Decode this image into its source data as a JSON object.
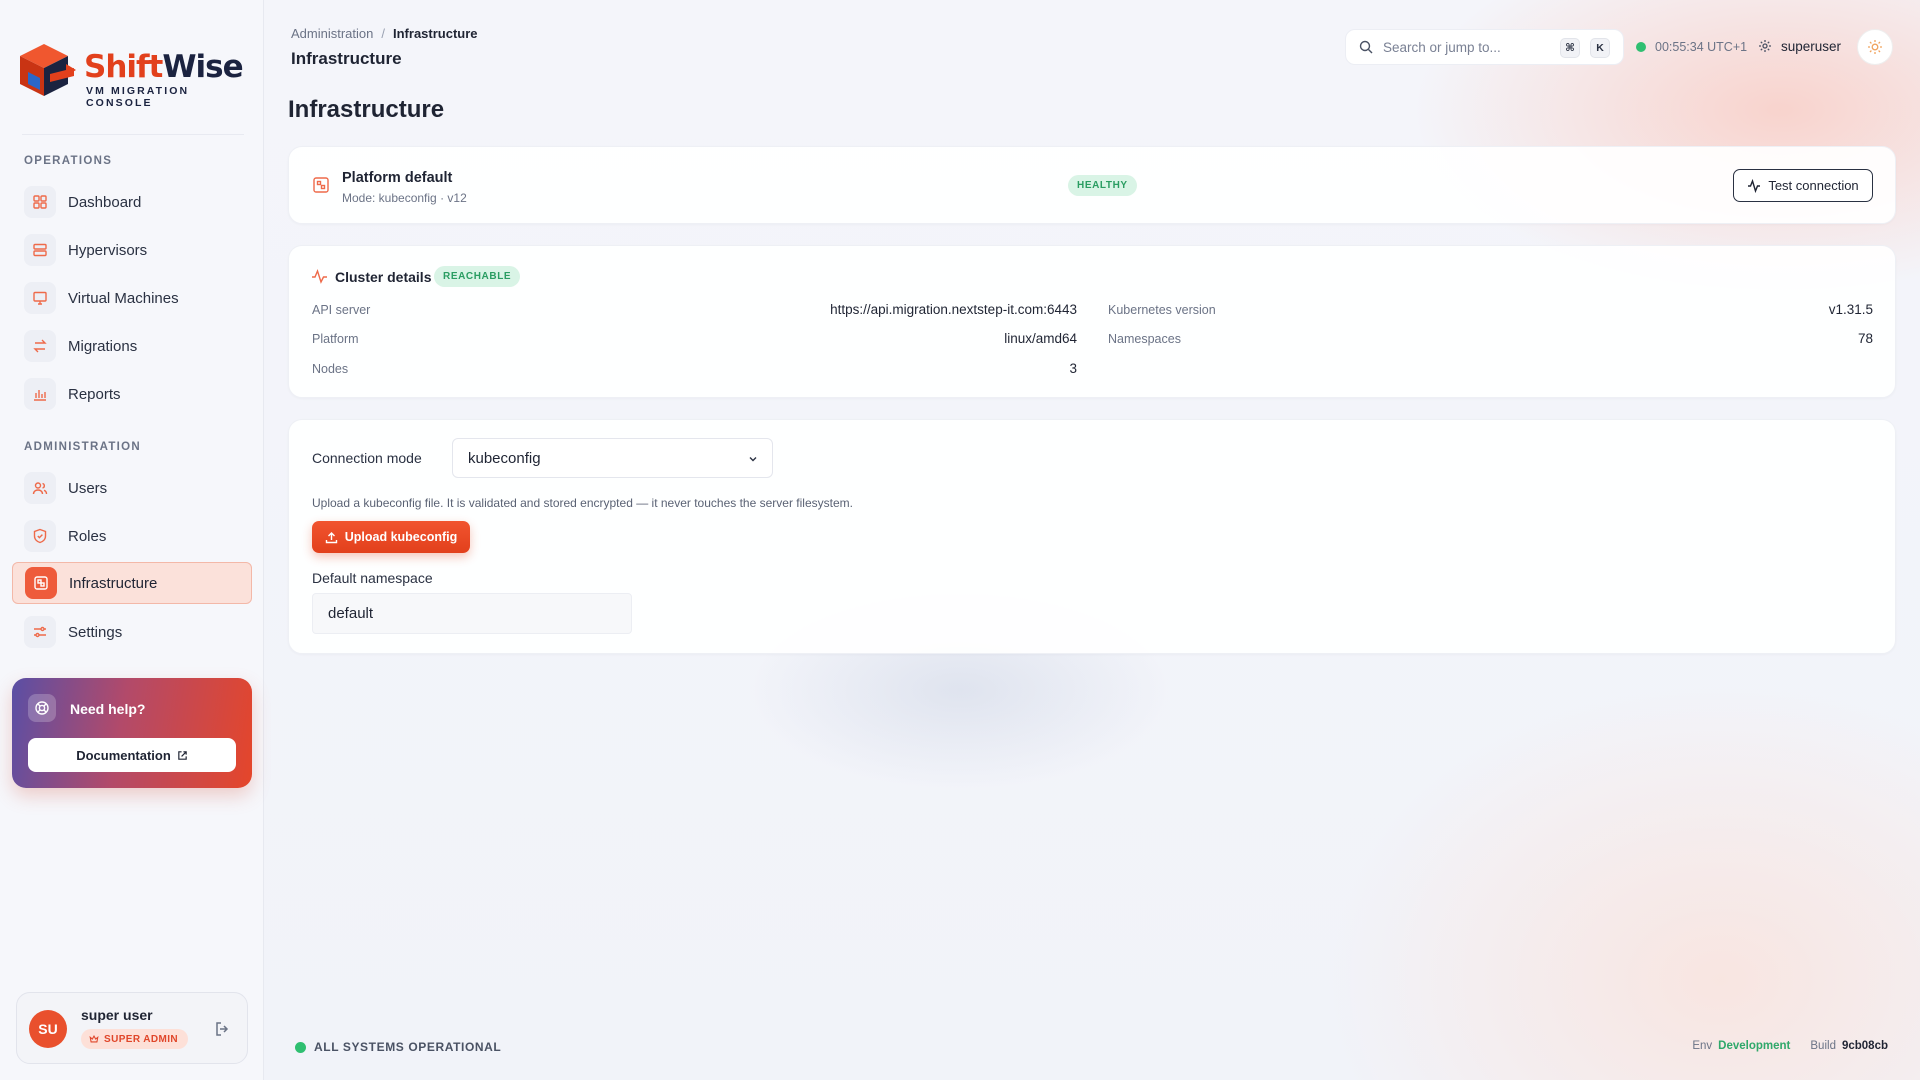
{
  "brand": {
    "name_part1": "Shift",
    "name_part2": "Wise",
    "subtitle": "VM MIGRATION CONSOLE"
  },
  "sidebar": {
    "sections": [
      {
        "title": "OPERATIONS",
        "items": [
          {
            "label": "Dashboard",
            "icon": "grid-icon"
          },
          {
            "label": "Hypervisors",
            "icon": "server-icon"
          },
          {
            "label": "Virtual Machines",
            "icon": "monitor-icon"
          },
          {
            "label": "Migrations",
            "icon": "arrows-icon"
          },
          {
            "label": "Reports",
            "icon": "bar-chart-icon"
          }
        ]
      },
      {
        "title": "ADMINISTRATION",
        "items": [
          {
            "label": "Users",
            "icon": "users-icon"
          },
          {
            "label": "Roles",
            "icon": "shield-icon"
          },
          {
            "label": "Infrastructure",
            "icon": "cluster-icon",
            "active": true
          },
          {
            "label": "Settings",
            "icon": "sliders-icon"
          }
        ]
      }
    ],
    "help": {
      "title": "Need help?",
      "button": "Documentation"
    },
    "user": {
      "initials": "SU",
      "name": "super user",
      "role": "SUPER ADMIN"
    }
  },
  "header": {
    "breadcrumb": [
      "Administration",
      "Infrastructure"
    ],
    "title": "Infrastructure",
    "search_placeholder": "Search or jump to...",
    "shortcut_keys": [
      "⌘",
      "K"
    ],
    "clock": "00:55:34 UTC+1",
    "username": "superuser"
  },
  "main": {
    "title": "Infrastructure",
    "platform": {
      "name": "Platform default",
      "mode": "Mode: kubeconfig · v12",
      "status": "HEALTHY",
      "test_button": "Test connection"
    },
    "cluster": {
      "title": "Cluster details",
      "status": "REACHABLE",
      "left": [
        {
          "key": "API server",
          "value": "https://api.migration.nextstep-it.com:6443"
        },
        {
          "key": "Platform",
          "value": "linux/amd64"
        },
        {
          "key": "Nodes",
          "value": "3"
        }
      ],
      "right": [
        {
          "key": "Kubernetes version",
          "value": "v1.31.5"
        },
        {
          "key": "Namespaces",
          "value": "78"
        }
      ]
    },
    "connection": {
      "mode_label": "Connection mode",
      "mode_value": "kubeconfig",
      "helper": "Upload a kubeconfig file. It is validated and stored encrypted — it never touches the server filesystem.",
      "upload_button": "Upload kubeconfig",
      "namespace_label": "Default namespace",
      "namespace_value": "default"
    }
  },
  "footer": {
    "status": "ALL SYSTEMS OPERATIONAL",
    "env_label": "Env",
    "env_value": "Development",
    "build_label": "Build",
    "build_value": "9cb08cb"
  },
  "colors": {
    "accent": "#e2401c",
    "success": "#2fbf71",
    "navy": "#1b2340"
  }
}
